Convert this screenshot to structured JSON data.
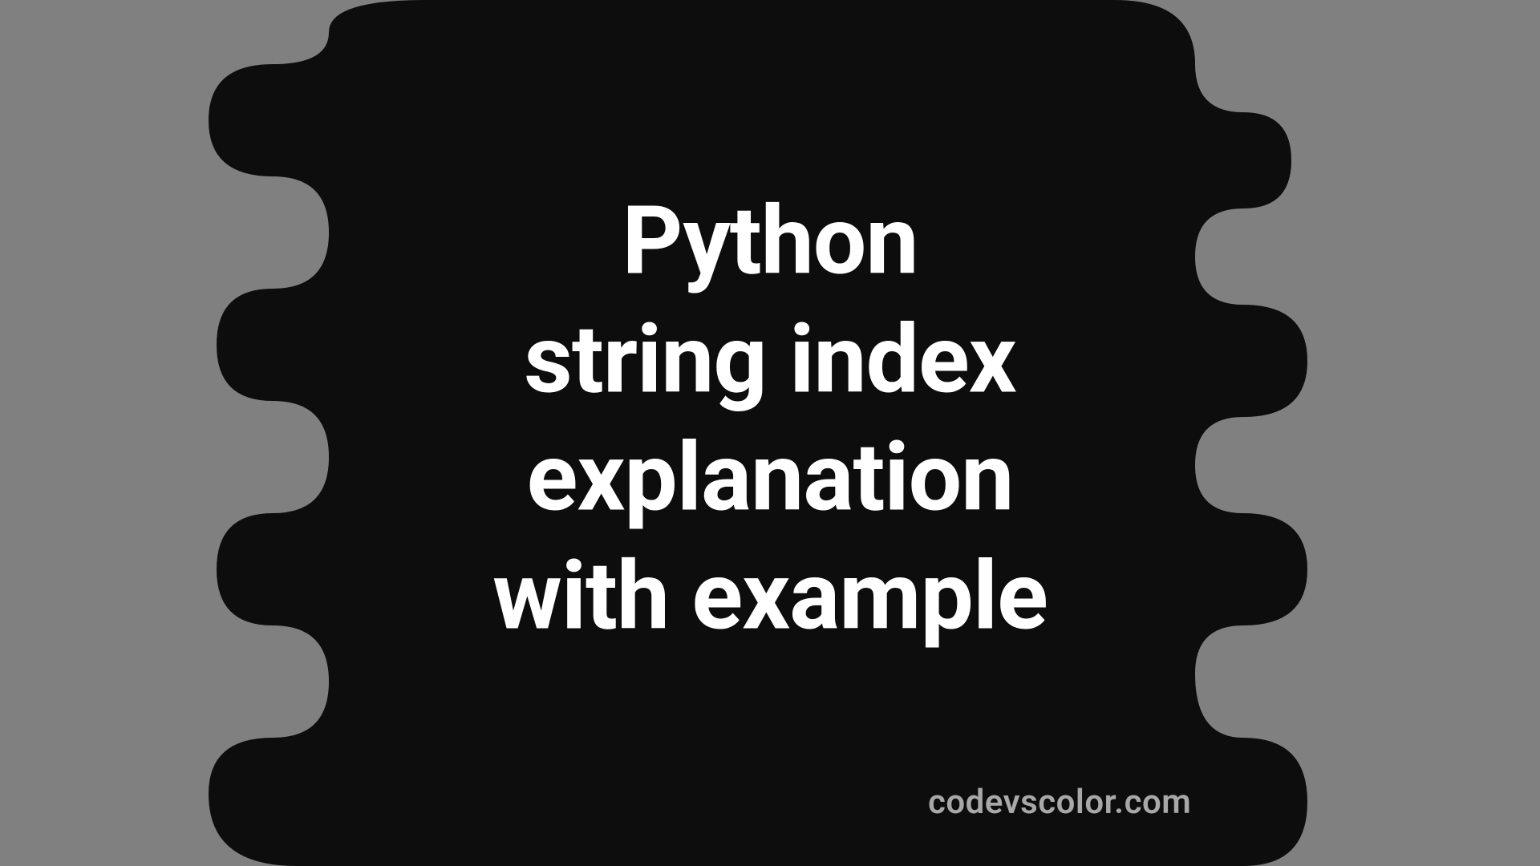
{
  "title_lines": {
    "line1": "Python",
    "line2": "string index",
    "line3": "explanation",
    "line4": "with example"
  },
  "watermark": "codevscolor.com",
  "colors": {
    "background": "#808080",
    "blob": "#0d0d0d",
    "text": "#ffffff",
    "watermark": "#a8a8a8"
  }
}
